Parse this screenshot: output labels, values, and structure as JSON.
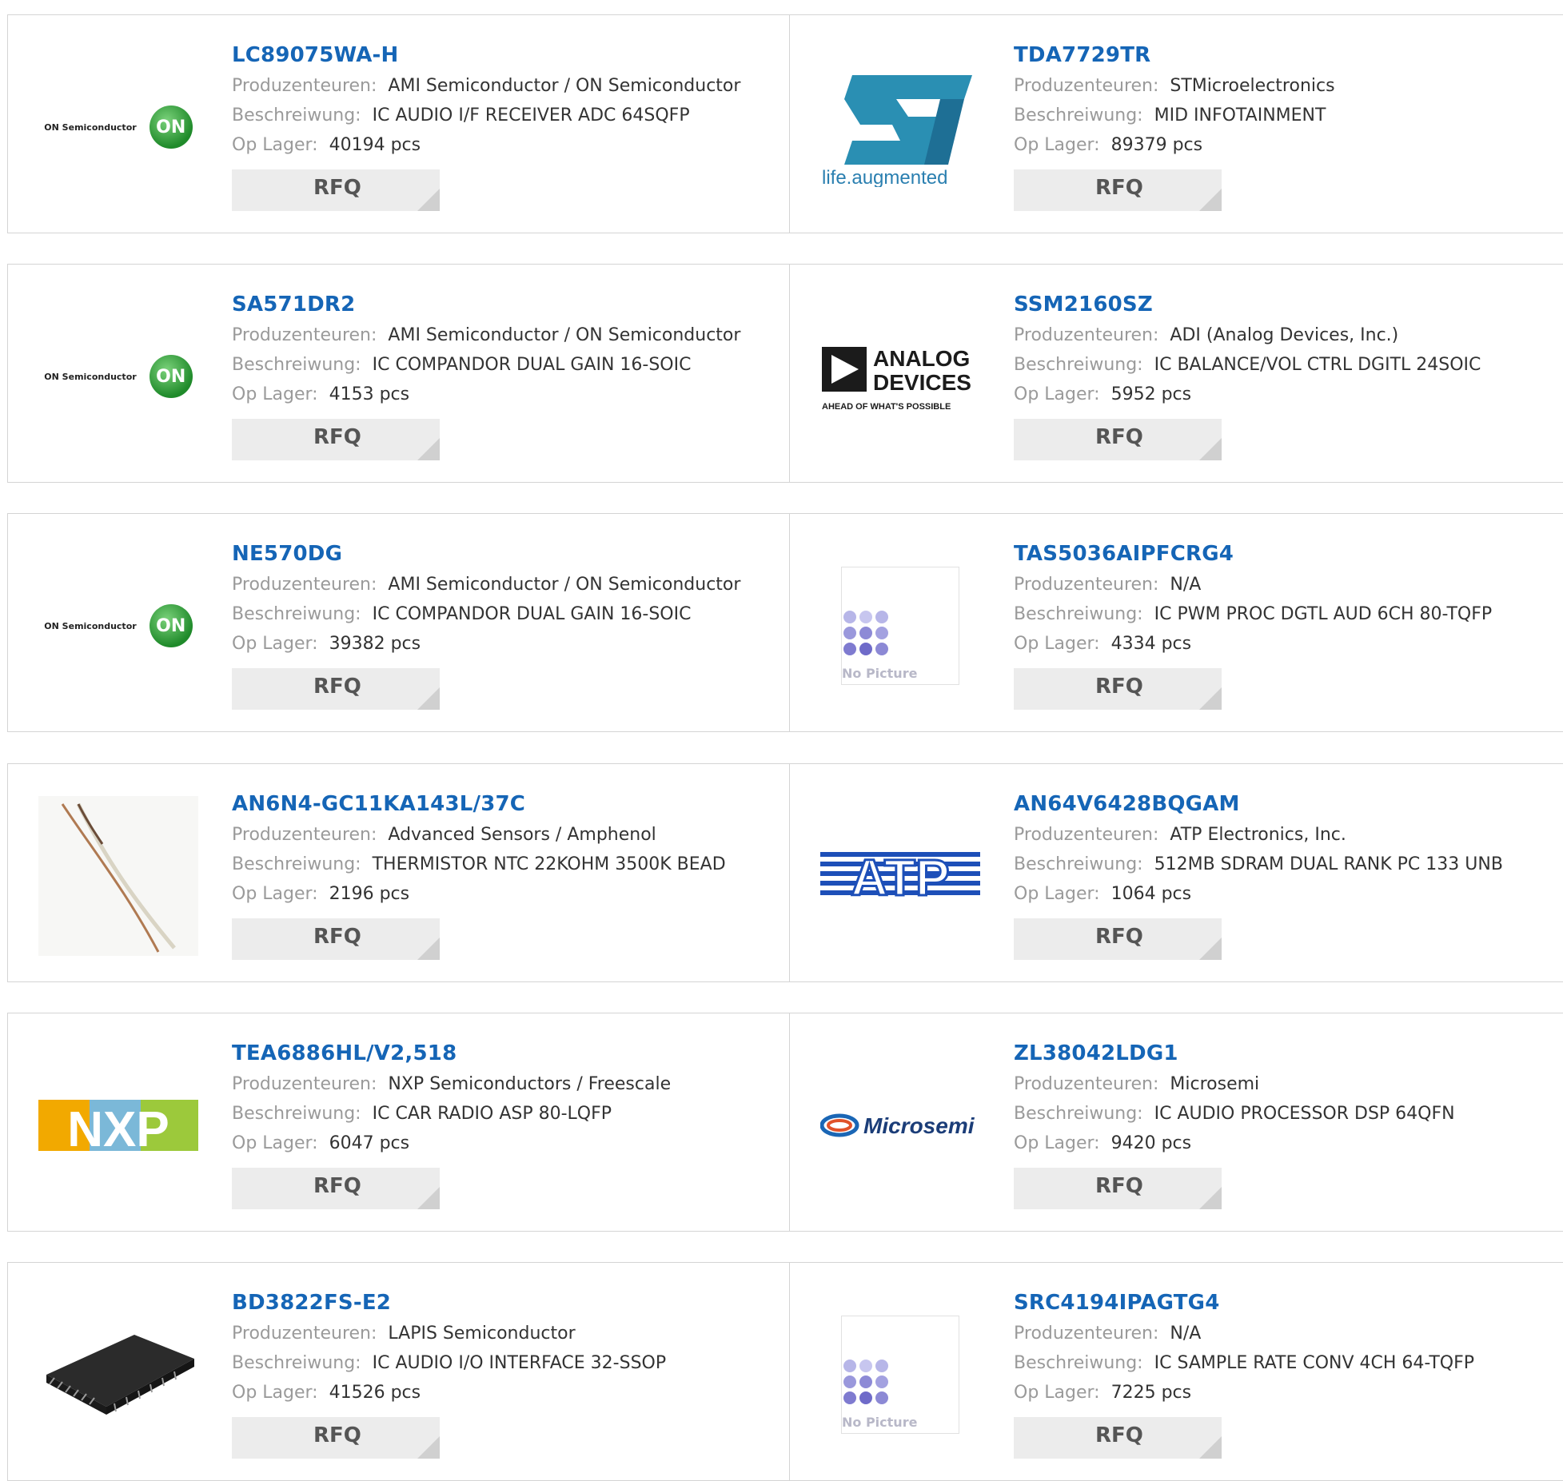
{
  "labels": {
    "manufacturer": "Produzenteuren:",
    "description": "Beschreiwung:",
    "stock": "Op Lager:",
    "rfq": "RFQ"
  },
  "products": [
    {
      "part": "LC89075WA-H",
      "manufacturer": "AMI Semiconductor / ON Semiconductor",
      "description": "IC AUDIO I/F RECEIVER ADC 64SQFP",
      "stock": "40194 pcs",
      "logo": "on-semiconductor-logo"
    },
    {
      "part": "TDA7729TR",
      "manufacturer": "STMicroelectronics",
      "description": "MID INFOTAINMENT",
      "stock": "89379 pcs",
      "logo": "st-logo"
    },
    {
      "part": "SA571DR2",
      "manufacturer": "AMI Semiconductor / ON Semiconductor",
      "description": "IC COMPANDOR DUAL GAIN 16-SOIC",
      "stock": "4153 pcs",
      "logo": "on-semiconductor-logo"
    },
    {
      "part": "SSM2160SZ",
      "manufacturer": "ADI (Analog Devices, Inc.)",
      "description": "IC BALANCE/VOL CTRL DGITL 24SOIC",
      "stock": "5952 pcs",
      "logo": "analog-devices-logo"
    },
    {
      "part": "NE570DG",
      "manufacturer": "AMI Semiconductor / ON Semiconductor",
      "description": "IC COMPANDOR DUAL GAIN 16-SOIC",
      "stock": "39382 pcs",
      "logo": "on-semiconductor-logo"
    },
    {
      "part": "TAS5036AIPFCRG4",
      "manufacturer": "N/A",
      "description": "IC PWM PROC DGTL AUD 6CH 80-TQFP",
      "stock": "4334 pcs",
      "logo": "no-picture"
    },
    {
      "part": "AN6N4-GC11KA143L/37C",
      "manufacturer": "Advanced Sensors / Amphenol",
      "description": "THERMISTOR NTC 22KOHM 3500K BEAD",
      "stock": "2196 pcs",
      "logo": "thermistor-photo"
    },
    {
      "part": "AN64V6428BQGAM",
      "manufacturer": "ATP Electronics, Inc.",
      "description": "512MB SDRAM DUAL RANK PC 133 UNB",
      "stock": "1064 pcs",
      "logo": "atp-logo"
    },
    {
      "part": "TEA6886HL/V2,518",
      "manufacturer": "NXP Semiconductors / Freescale",
      "description": "IC CAR RADIO ASP 80-LQFP",
      "stock": "6047 pcs",
      "logo": "nxp-logo"
    },
    {
      "part": "ZL38042LDG1",
      "manufacturer": "Microsemi",
      "description": "IC AUDIO PROCESSOR DSP 64QFN",
      "stock": "9420 pcs",
      "logo": "microsemi-logo"
    },
    {
      "part": "BD3822FS-E2",
      "manufacturer": "LAPIS Semiconductor",
      "description": "IC AUDIO I/O INTERFACE 32-SSOP",
      "stock": "41526 pcs",
      "logo": "ic-chip-photo"
    },
    {
      "part": "SRC4194IPAGTG4",
      "manufacturer": "N/A",
      "description": "IC SAMPLE RATE CONV 4CH 64-TQFP",
      "stock": "7225 pcs",
      "logo": "no-picture"
    }
  ],
  "logo_text": {
    "on_brand": "ON Semiconductor",
    "on_mark": "ON",
    "st_tagline": "life.augmented",
    "adi_line1": "ANALOG",
    "adi_line2": "DEVICES",
    "adi_tagline": "AHEAD OF WHAT'S POSSIBLE",
    "atp": "ATP",
    "nxp": "NXP",
    "microsemi": "Microsemi",
    "no_picture": "No Picture"
  },
  "colors": {
    "part_link": "#1565b6",
    "label": "#9a9a9a",
    "value": "#333333",
    "rfq_bg": "#ececec",
    "border": "#d4d4d4"
  }
}
